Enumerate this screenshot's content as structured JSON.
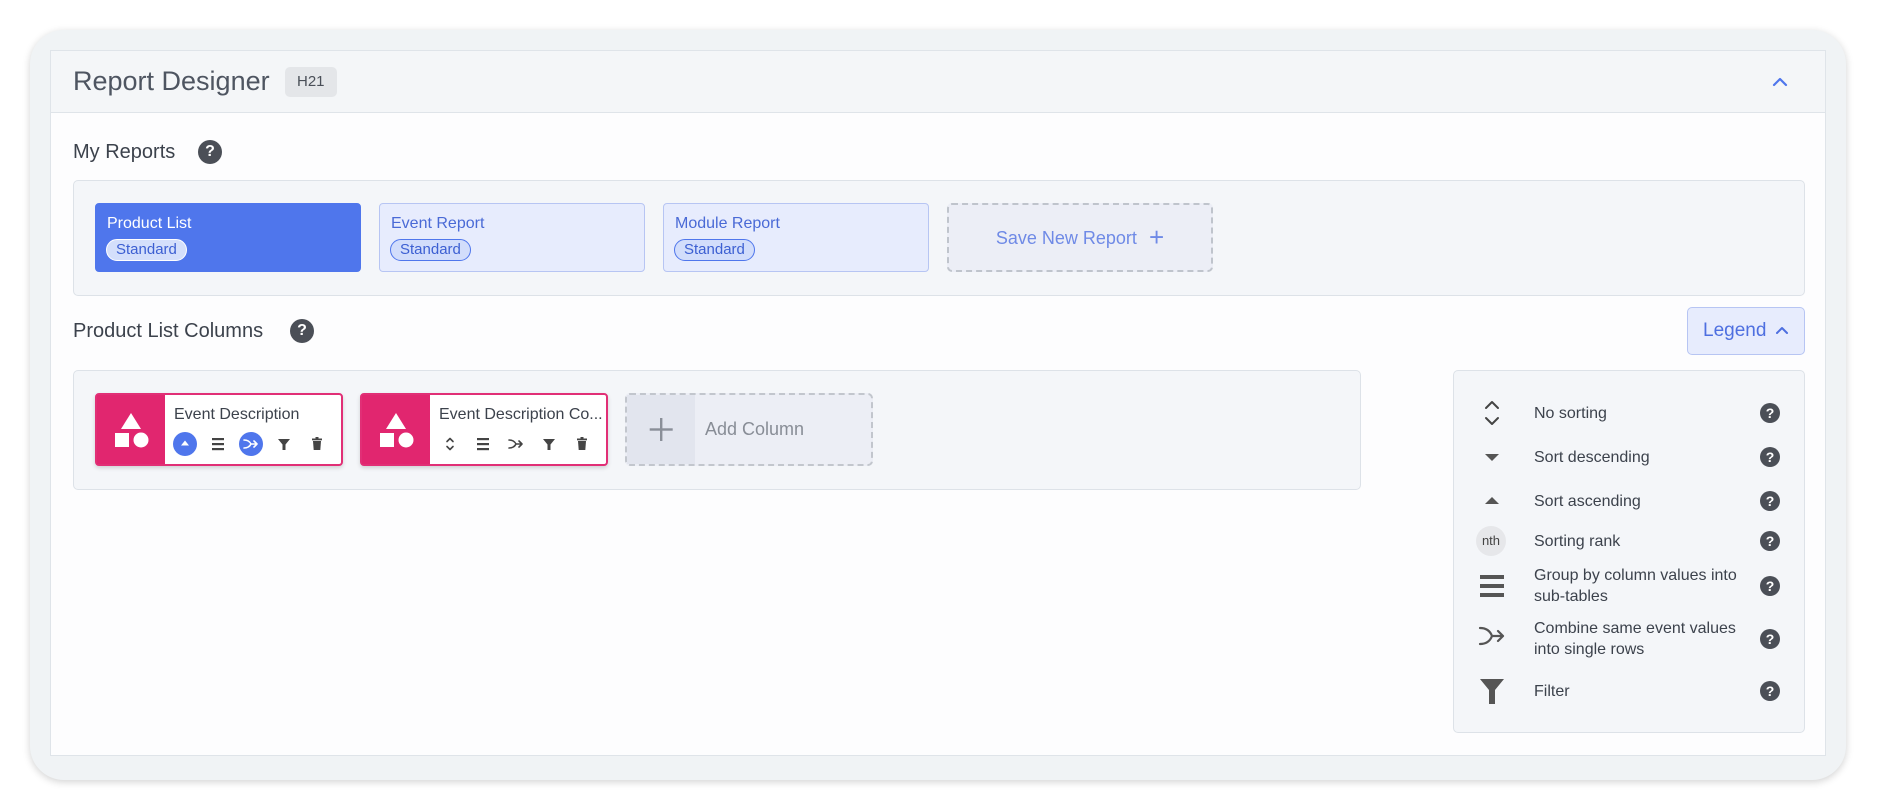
{
  "header": {
    "title": "Report Designer",
    "badge": "H21"
  },
  "my_reports": {
    "title": "My Reports",
    "help": "?",
    "reports": [
      {
        "name": "Product List",
        "badge": "Standard",
        "active": true
      },
      {
        "name": "Event Report",
        "badge": "Standard",
        "active": false
      },
      {
        "name": "Module Report",
        "badge": "Standard",
        "active": false
      }
    ],
    "save_new_label": "Save New Report",
    "save_new_plus": "+"
  },
  "columns": {
    "title": "Product List Columns",
    "help": "?",
    "legend_button": "Legend",
    "items": [
      {
        "title": "Event Description"
      },
      {
        "title": "Event Description Co..."
      }
    ],
    "add_column_label": "Add Column"
  },
  "legend": {
    "help": "?",
    "items": [
      {
        "icon": "no-sort-icon",
        "text": "No sorting"
      },
      {
        "icon": "sort-descending-icon",
        "text": "Sort descending"
      },
      {
        "icon": "sort-ascending-icon",
        "text": "Sort ascending"
      },
      {
        "icon": "sorting-rank-icon",
        "text": "Sorting rank",
        "chip": "nth"
      },
      {
        "icon": "group-by-icon",
        "text": "Group by column values into sub-tables"
      },
      {
        "icon": "combine-icon",
        "text": "Combine same event values into single rows"
      },
      {
        "icon": "filter-icon",
        "text": "Filter"
      }
    ]
  },
  "colors": {
    "primary": "#4f76ec",
    "column_accent": "#e1266f"
  }
}
